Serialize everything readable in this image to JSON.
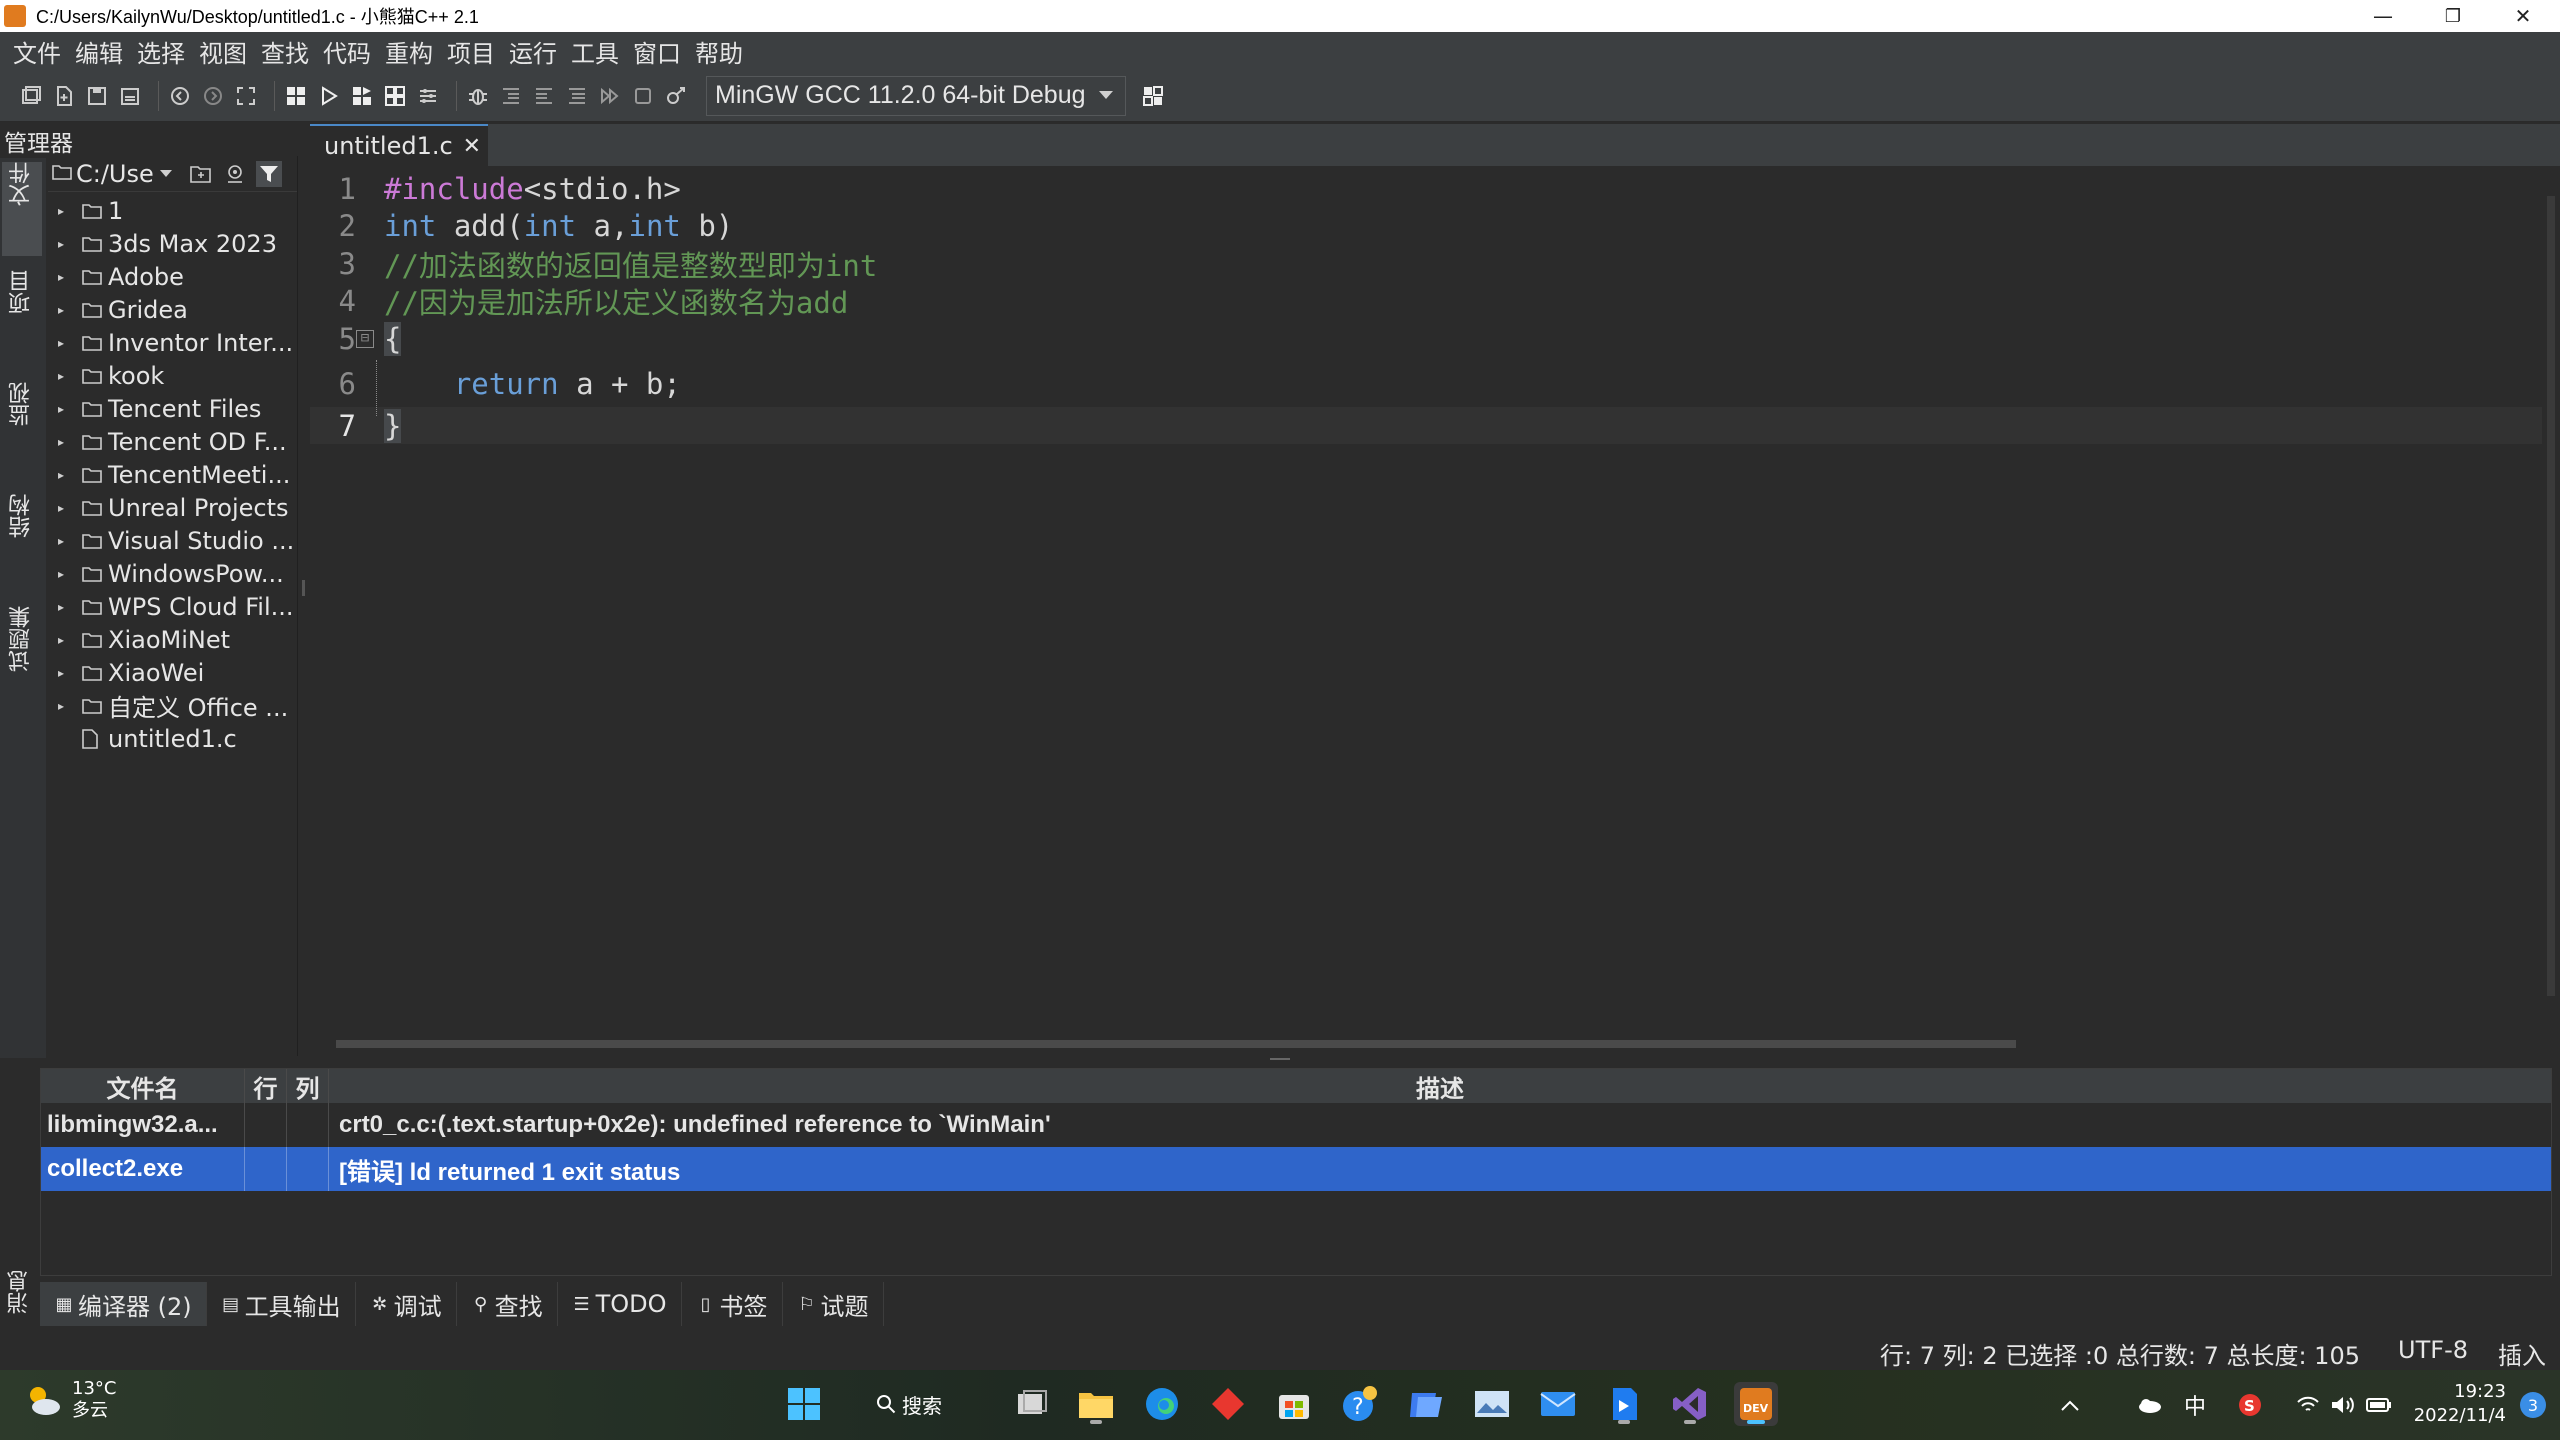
{
  "window": {
    "title": "C:/Users/KailynWu/Desktop/untitled1.c - 小熊猫C++ 2.1",
    "minimize_glyph": "—",
    "restore_glyph": "❐",
    "close_glyph": "✕"
  },
  "menu": [
    "文件",
    "编辑",
    "选择",
    "视图",
    "查找",
    "代码",
    "重构",
    "项目",
    "运行",
    "工具",
    "窗口",
    "帮助"
  ],
  "toolbar": {
    "compiler": "MinGW GCC 11.2.0 64-bit Debug"
  },
  "left_vtabs": [
    "文件",
    "项目",
    "监视",
    "结构",
    "试题集"
  ],
  "manager": {
    "title": "管理器",
    "path": "C:/Use",
    "tree": [
      {
        "label": "1",
        "type": "folder"
      },
      {
        "label": "3ds Max 2023",
        "type": "folder"
      },
      {
        "label": "Adobe",
        "type": "folder"
      },
      {
        "label": "Gridea",
        "type": "folder"
      },
      {
        "label": "Inventor Inter...",
        "type": "folder"
      },
      {
        "label": "kook",
        "type": "folder"
      },
      {
        "label": "Tencent Files",
        "type": "folder"
      },
      {
        "label": "Tencent OD F...",
        "type": "folder"
      },
      {
        "label": "TencentMeeti...",
        "type": "folder"
      },
      {
        "label": "Unreal Projects",
        "type": "folder"
      },
      {
        "label": "Visual Studio ...",
        "type": "folder"
      },
      {
        "label": "WindowsPow...",
        "type": "folder"
      },
      {
        "label": "WPS Cloud Fil...",
        "type": "folder"
      },
      {
        "label": "XiaoMiNet",
        "type": "folder"
      },
      {
        "label": "XiaoWei",
        "type": "folder"
      },
      {
        "label": "自定义 Office ...",
        "type": "folder"
      },
      {
        "label": "untitled1.c",
        "type": "file"
      }
    ]
  },
  "editor": {
    "tab_label": "untitled1.c",
    "tab_close": "✕",
    "current_line": 7,
    "lines": [
      {
        "n": "1",
        "tokens": [
          [
            "pp",
            "#include"
          ],
          [
            "id",
            "<stdio.h>"
          ]
        ]
      },
      {
        "n": "2",
        "tokens": [
          [
            "kw",
            "int"
          ],
          [
            "id",
            " add("
          ],
          [
            "kw",
            "int"
          ],
          [
            "id",
            " a,"
          ],
          [
            "kw",
            "int"
          ],
          [
            "id",
            " b)"
          ]
        ]
      },
      {
        "n": "3",
        "tokens": [
          [
            "cm",
            "//加法函数的返回值是整数型即为int"
          ]
        ]
      },
      {
        "n": "4",
        "tokens": [
          [
            "cm",
            "//因为是加法所以定义函数名为add"
          ]
        ]
      },
      {
        "n": "5",
        "tokens": [
          [
            "br",
            "{"
          ]
        ],
        "fold": "⊟"
      },
      {
        "n": "6",
        "tokens": [
          [
            "id",
            "    "
          ],
          [
            "kw",
            "return"
          ],
          [
            "id",
            " a + b;"
          ]
        ]
      },
      {
        "n": "7",
        "tokens": [
          [
            "br",
            "}"
          ]
        ]
      }
    ]
  },
  "messages": {
    "headers": {
      "file": "文件名",
      "line": "行",
      "col": "列",
      "desc": "描述"
    },
    "rows": [
      {
        "file": "libmingw32.a...",
        "line": "",
        "col": "",
        "desc": "crt0_c.c:(.text.startup+0x2e): undefined reference to `WinMain'",
        "selected": false
      },
      {
        "file": "collect2.exe",
        "line": "",
        "col": "",
        "desc": "[错误] ld returned 1 exit status",
        "selected": true
      }
    ],
    "side_tab": "消息"
  },
  "bottom_tabs": [
    {
      "label": "编译器 (2)",
      "icon": "compiler-icon",
      "active": true
    },
    {
      "label": "工具输出",
      "icon": "tool-output-icon",
      "active": false
    },
    {
      "label": "调试",
      "icon": "debug-icon",
      "active": false
    },
    {
      "label": "查找",
      "icon": "search-icon",
      "active": false
    },
    {
      "label": "TODO",
      "icon": "todo-icon",
      "active": false
    },
    {
      "label": "书签",
      "icon": "bookmark-icon",
      "active": false
    },
    {
      "label": "试题",
      "icon": "problem-icon",
      "active": false
    }
  ],
  "status": {
    "position": "行: 7 列: 2 已选择 :0 总行数: 7 总长度: 105",
    "encoding": "UTF-8",
    "mode": "插入"
  },
  "taskbar": {
    "weather_temp": "13°C",
    "weather_desc": "多云",
    "search_label": "搜索",
    "ime": "中",
    "time": "19:23",
    "date": "2022/11/4",
    "notifications": "3",
    "colors": {
      "accent": "#2f65ca",
      "brand_orange": "#e07b1f"
    }
  }
}
